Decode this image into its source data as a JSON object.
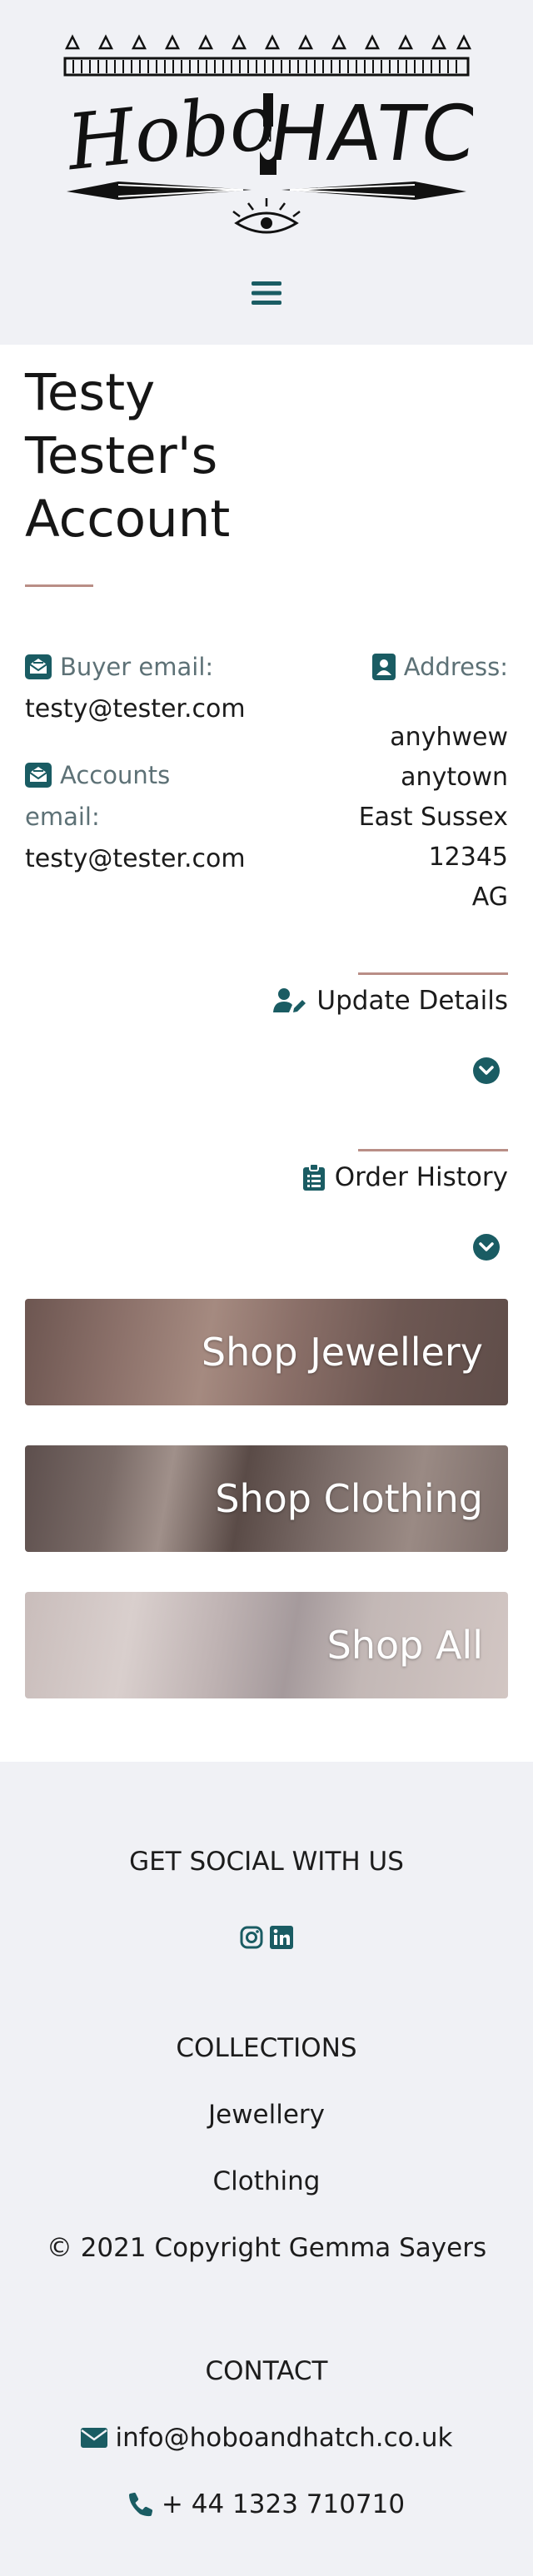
{
  "header": {
    "logo_text": "Hobo and HATCH",
    "menu_icon": "hamburger-icon"
  },
  "account": {
    "title": "Testy Tester's Account",
    "buyer_email_label": "Buyer email:",
    "buyer_email": "testy@tester.com",
    "accounts_email_label_1": "Accounts",
    "accounts_email_label_2": "email:",
    "accounts_email": "testy@tester.com",
    "address_label": "Address:",
    "address_lines": [
      "anyhwew",
      "anytown",
      "East Sussex",
      "12345",
      "AG"
    ]
  },
  "sections": {
    "update_details": "Update Details",
    "order_history": "Order History"
  },
  "shop_links": {
    "jewellery": "Shop Jewellery",
    "clothing": "Shop Clothing",
    "all": "Shop All"
  },
  "footer": {
    "social_heading": "GET SOCIAL WITH US",
    "collections_heading": "COLLECTIONS",
    "jewellery": "Jewellery",
    "clothing": "Clothing",
    "copyright": "© 2021 Copyright Gemma Sayers",
    "contact_heading": "CONTACT",
    "email": "info@hoboandhatch.co.uk",
    "phone": "+ 44 1323 710710"
  },
  "colors": {
    "accent": "#1a5c63",
    "rule": "#b98e86",
    "label": "#5d7176",
    "page_bg": "#f0f1f5"
  }
}
